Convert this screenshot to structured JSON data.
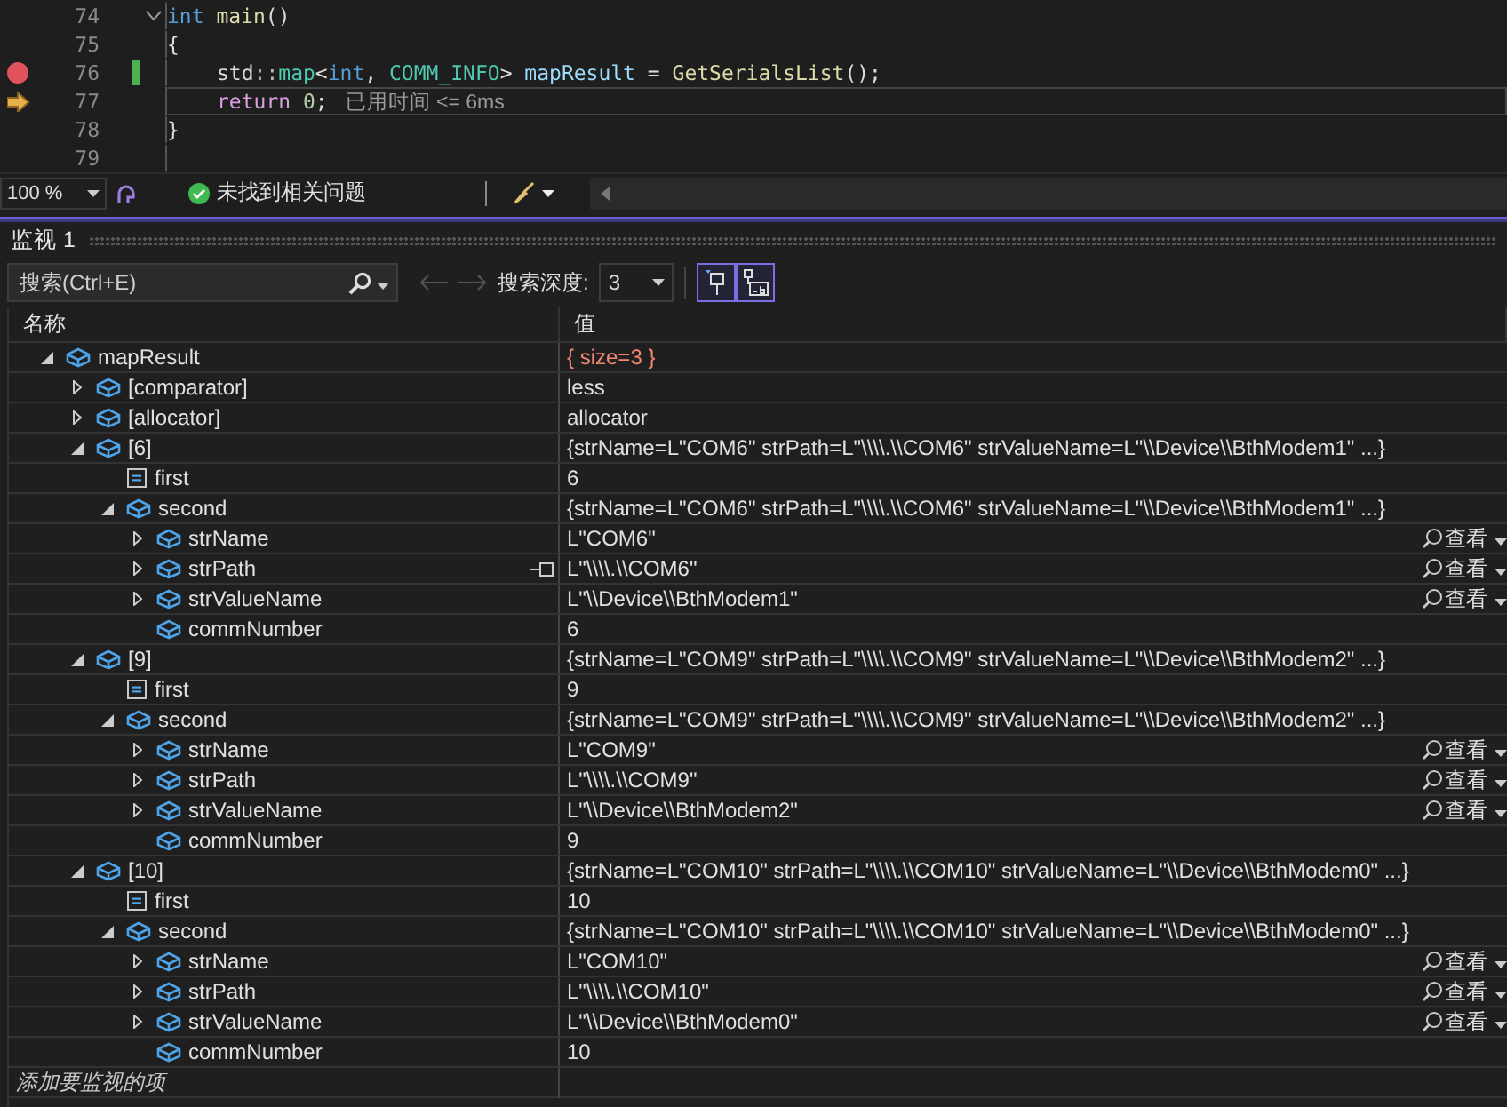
{
  "editor": {
    "lines": [
      {
        "number": "74",
        "kind": "top",
        "fold": true,
        "breakpoint": false,
        "current": false,
        "changed": false,
        "tokens": [
          {
            "kind": "keyword",
            "text": "int"
          },
          {
            "kind": "func",
            "text": " main"
          },
          {
            "kind": "plain",
            "text": "()"
          }
        ]
      },
      {
        "number": "75",
        "kind": "top",
        "fold": false,
        "breakpoint": false,
        "current": false,
        "changed": false,
        "tokens": [
          {
            "kind": "plain",
            "text": "{"
          }
        ]
      },
      {
        "number": "76",
        "kind": "body",
        "fold": false,
        "breakpoint": true,
        "current": false,
        "changed": true,
        "tokens": [
          {
            "kind": "plain",
            "text": "std"
          },
          {
            "kind": "punct",
            "text": "::"
          },
          {
            "kind": "type",
            "text": "map"
          },
          {
            "kind": "plain",
            "text": "<"
          },
          {
            "kind": "keyword",
            "text": "int"
          },
          {
            "kind": "plain",
            "text": ", "
          },
          {
            "kind": "type",
            "text": "COMM_INFO"
          },
          {
            "kind": "plain",
            "text": "> "
          },
          {
            "kind": "var",
            "text": "mapResult"
          },
          {
            "kind": "plain",
            "text": " = "
          },
          {
            "kind": "func",
            "text": "GetSerialsList"
          },
          {
            "kind": "plain",
            "text": "();"
          }
        ]
      },
      {
        "number": "77",
        "kind": "body",
        "fold": false,
        "breakpoint": false,
        "current": true,
        "changed": false,
        "tokens": [
          {
            "kind": "control",
            "text": "return"
          },
          {
            "kind": "number",
            "text": " 0"
          },
          {
            "kind": "plain",
            "text": ";"
          },
          {
            "kind": "hint",
            "text": "已用时间 <= 6ms"
          }
        ]
      },
      {
        "number": "78",
        "kind": "top",
        "fold": false,
        "breakpoint": false,
        "current": false,
        "changed": false,
        "tokens": [
          {
            "kind": "plain",
            "text": "}"
          }
        ]
      },
      {
        "number": "79",
        "kind": "top",
        "fold": false,
        "breakpoint": false,
        "current": false,
        "changed": false
      }
    ]
  },
  "status_bar": {
    "zoom": "100 %",
    "issues": "未找到相关问题"
  },
  "watch": {
    "title": "监视 1",
    "search": {
      "placeholder": "搜索(Ctrl+E)"
    },
    "depth_label": "搜索深度:",
    "depth": "3",
    "columns": [
      "名称",
      "值"
    ],
    "rows": [
      {
        "name": "mapResult",
        "value": "{ size=3 }",
        "kind": "object",
        "changed": true,
        "hovered": false,
        "expanded": true,
        "children": [
          {
            "name": "[comparator]",
            "value": "less",
            "kind": "object",
            "changed": false,
            "hovered": false,
            "expanded": false
          },
          {
            "name": "[allocator]",
            "value": "allocator",
            "kind": "object",
            "changed": false,
            "hovered": false,
            "expanded": false
          },
          {
            "name": "[6]",
            "value": "{strName=L\"COM6\" strPath=L\"\\\\\\\\.\\\\COM6\" strValueName=L\"\\\\Device\\\\BthModem1\" ...}",
            "kind": "object",
            "changed": false,
            "hovered": false,
            "expanded": true,
            "children": [
              {
                "name": "first",
                "value": "6",
                "kind": "field",
                "changed": false,
                "hovered": false
              },
              {
                "name": "second",
                "value": "{strName=L\"COM6\" strPath=L\"\\\\\\\\.\\\\COM6\" strValueName=L\"\\\\Device\\\\BthModem1\" ...}",
                "kind": "object",
                "changed": false,
                "hovered": false,
                "expanded": true,
                "children": [
                  {
                    "name": "strName",
                    "value": "L\"COM6\"",
                    "kind": "object",
                    "changed": false,
                    "hovered": false,
                    "expanded": false,
                    "view_button": "查看"
                  },
                  {
                    "name": "strPath",
                    "value": "L\"\\\\\\\\.\\\\COM6\"",
                    "kind": "object",
                    "changed": false,
                    "hovered": true,
                    "expanded": false,
                    "view_button": "查看"
                  },
                  {
                    "name": "strValueName",
                    "value": "L\"\\\\Device\\\\BthModem1\"",
                    "kind": "object",
                    "changed": false,
                    "hovered": false,
                    "expanded": false,
                    "view_button": "查看"
                  },
                  {
                    "name": "commNumber",
                    "value": "6",
                    "kind": "object",
                    "changed": false,
                    "hovered": false
                  }
                ]
              }
            ]
          },
          {
            "name": "[9]",
            "value": "{strName=L\"COM9\" strPath=L\"\\\\\\\\.\\\\COM9\" strValueName=L\"\\\\Device\\\\BthModem2\" ...}",
            "kind": "object",
            "changed": false,
            "hovered": false,
            "expanded": true,
            "children": [
              {
                "name": "first",
                "value": "9",
                "kind": "field",
                "changed": false,
                "hovered": false
              },
              {
                "name": "second",
                "value": "{strName=L\"COM9\" strPath=L\"\\\\\\\\.\\\\COM9\" strValueName=L\"\\\\Device\\\\BthModem2\" ...}",
                "kind": "object",
                "changed": false,
                "hovered": false,
                "expanded": true,
                "children": [
                  {
                    "name": "strName",
                    "value": "L\"COM9\"",
                    "kind": "object",
                    "changed": false,
                    "hovered": false,
                    "expanded": false,
                    "view_button": "查看"
                  },
                  {
                    "name": "strPath",
                    "value": "L\"\\\\\\\\.\\\\COM9\"",
                    "kind": "object",
                    "changed": false,
                    "hovered": false,
                    "expanded": false,
                    "view_button": "查看"
                  },
                  {
                    "name": "strValueName",
                    "value": "L\"\\\\Device\\\\BthModem2\"",
                    "kind": "object",
                    "changed": false,
                    "hovered": false,
                    "expanded": false,
                    "view_button": "查看"
                  },
                  {
                    "name": "commNumber",
                    "value": "9",
                    "kind": "object",
                    "changed": false,
                    "hovered": false
                  }
                ]
              }
            ]
          },
          {
            "name": "[10]",
            "value": "{strName=L\"COM10\" strPath=L\"\\\\\\\\.\\\\COM10\" strValueName=L\"\\\\Device\\\\BthModem0\" ...}",
            "kind": "object",
            "changed": false,
            "hovered": false,
            "expanded": true,
            "children": [
              {
                "name": "first",
                "value": "10",
                "kind": "field",
                "changed": false,
                "hovered": false
              },
              {
                "name": "second",
                "value": "{strName=L\"COM10\" strPath=L\"\\\\\\\\.\\\\COM10\" strValueName=L\"\\\\Device\\\\BthModem0\" ...}",
                "kind": "object",
                "changed": false,
                "hovered": false,
                "expanded": true,
                "children": [
                  {
                    "name": "strName",
                    "value": "L\"COM10\"",
                    "kind": "object",
                    "changed": false,
                    "hovered": false,
                    "expanded": false,
                    "view_button": "查看"
                  },
                  {
                    "name": "strPath",
                    "value": "L\"\\\\\\\\.\\\\COM10\"",
                    "kind": "object",
                    "changed": false,
                    "hovered": false,
                    "expanded": false,
                    "view_button": "查看"
                  },
                  {
                    "name": "strValueName",
                    "value": "L\"\\\\Device\\\\BthModem0\"",
                    "kind": "object",
                    "changed": false,
                    "hovered": false,
                    "expanded": false,
                    "view_button": "查看"
                  },
                  {
                    "name": "commNumber",
                    "value": "10",
                    "kind": "object",
                    "changed": false,
                    "hovered": false
                  }
                ]
              }
            ]
          }
        ]
      }
    ],
    "add_placeholder": "添加要监视的项"
  }
}
